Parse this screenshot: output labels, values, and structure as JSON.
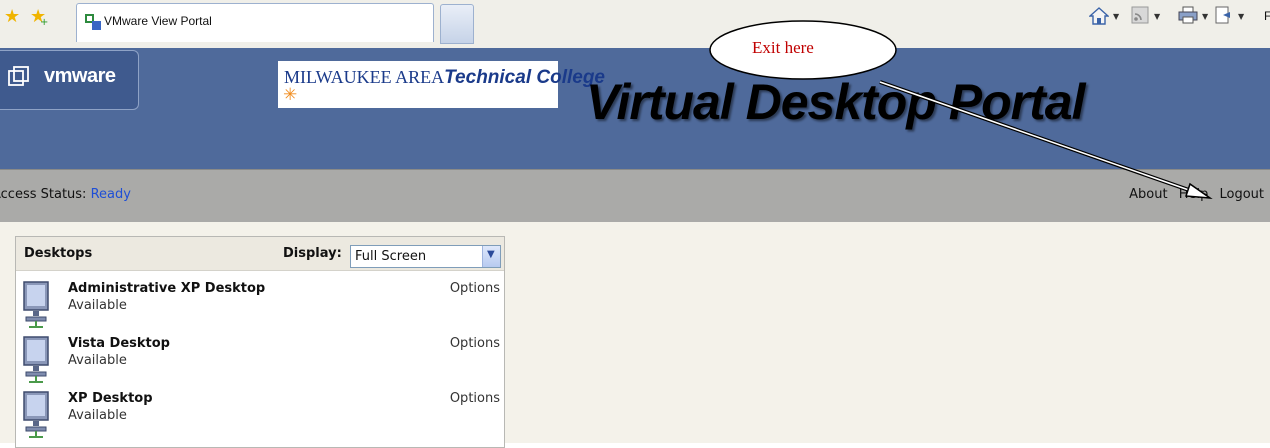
{
  "browser": {
    "tab_title": "VMware View Portal",
    "truncated_toolbar_text": "F"
  },
  "header": {
    "vmware_logo_text": "vmware",
    "college_logo": {
      "part1": "MILWAUKEE AREA",
      "part2": "Technical College"
    },
    "portal_title": "Virtual Desktop Portal"
  },
  "status": {
    "label": "Access Status:",
    "value": "Ready"
  },
  "nav": {
    "about": "About",
    "help": "Help",
    "logout": "Logout"
  },
  "desktops_panel": {
    "title": "Desktops",
    "display_label": "Display:",
    "display_value": "Full Screen",
    "rows": [
      {
        "name": "Administrative XP Desktop",
        "status": "Available",
        "options": "Options"
      },
      {
        "name": "Vista Desktop",
        "status": "Available",
        "options": "Options"
      },
      {
        "name": "XP Desktop",
        "status": "Available",
        "options": "Options"
      }
    ]
  },
  "annotation": {
    "callout_text": "Exit here",
    "color": "#c00000"
  },
  "colors": {
    "header_blue": "#4f6a9b",
    "status_gray": "#aaaaa8",
    "link_blue": "#1f4fd6"
  }
}
